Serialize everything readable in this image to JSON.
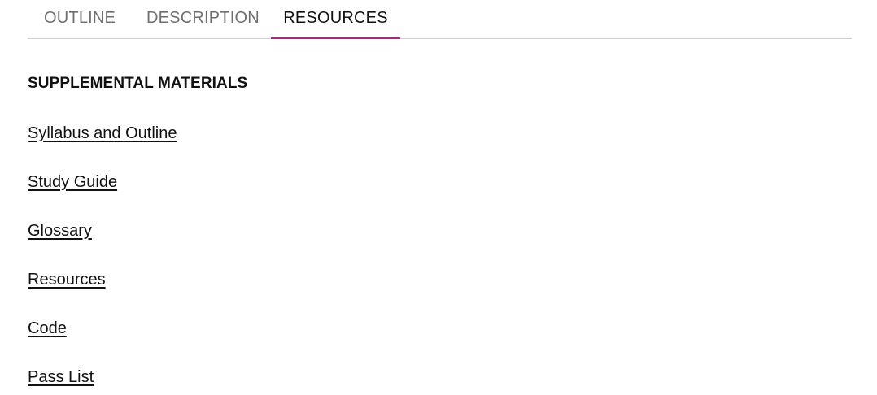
{
  "tabs": {
    "outline": "OUTLINE",
    "description": "DESCRIPTION",
    "resources": "RESOURCES",
    "active": "resources",
    "active_underline_color": "#b5227b"
  },
  "section": {
    "title": "SUPPLEMENTAL MATERIALS"
  },
  "links": [
    "Syllabus and Outline",
    "Study Guide",
    "Glossary",
    "Resources",
    "Code",
    "Pass List"
  ]
}
